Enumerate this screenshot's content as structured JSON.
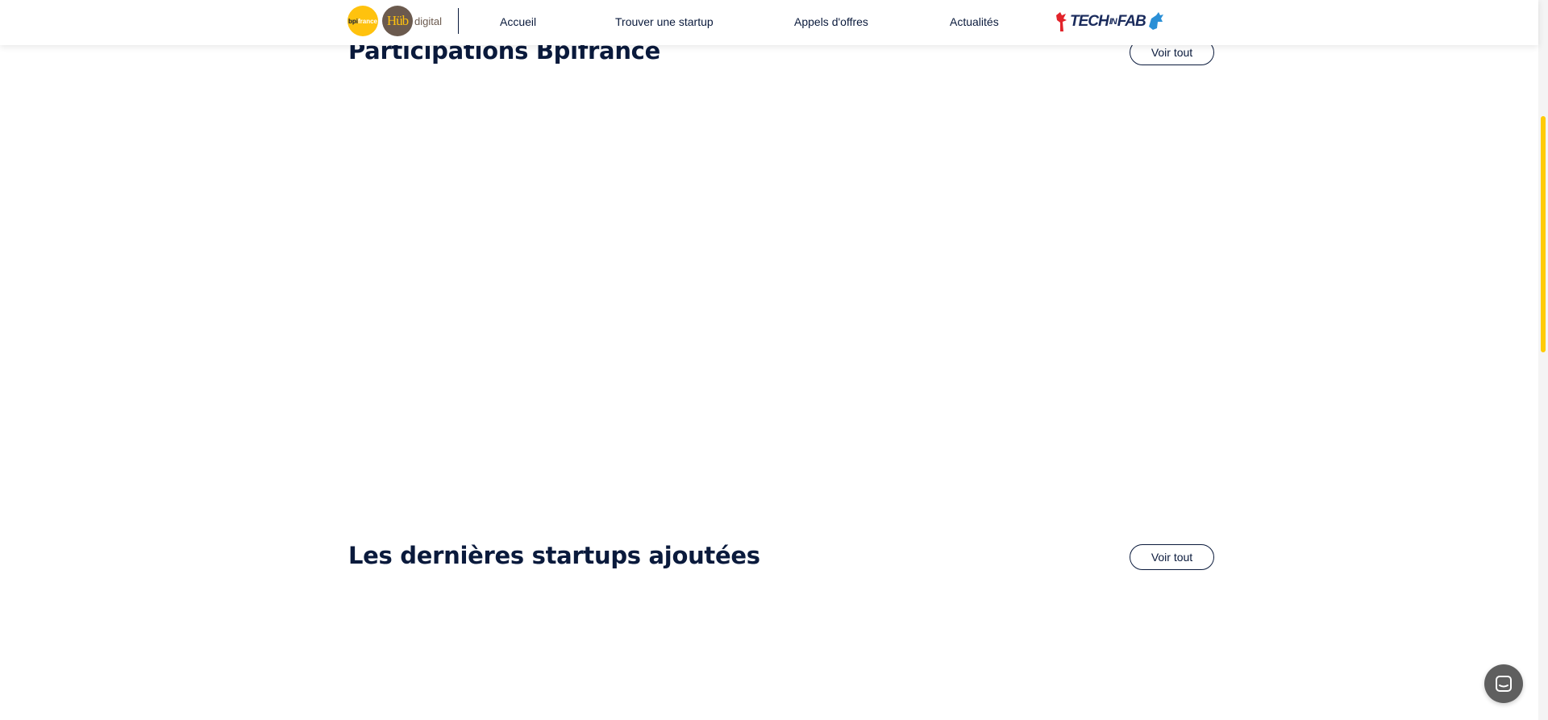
{
  "header": {
    "logos": {
      "bpi_text": "bpifrance",
      "hub_text": "Hüb",
      "digital_text": "digital",
      "techinfab": {
        "part1": "TECH",
        "part2": "IN",
        "part3": "FAB"
      }
    },
    "nav": [
      {
        "label": "Accueil"
      },
      {
        "label": "Trouver une startup"
      },
      {
        "label": "Appels d'offres"
      },
      {
        "label": "Actualités"
      }
    ]
  },
  "sections": [
    {
      "title": "Participations Bpifrance",
      "button_label": "Voir tout"
    },
    {
      "title": "Les dernières startups ajoutées",
      "button_label": "Voir tout"
    }
  ],
  "colors": {
    "brand_navy": "#0a1a3c",
    "brand_yellow": "#ffc20e",
    "hub_brown": "#6b5a4e",
    "chat_gray": "#5f5f5f"
  },
  "icons": {
    "chat": "chat-bubble-icon"
  }
}
